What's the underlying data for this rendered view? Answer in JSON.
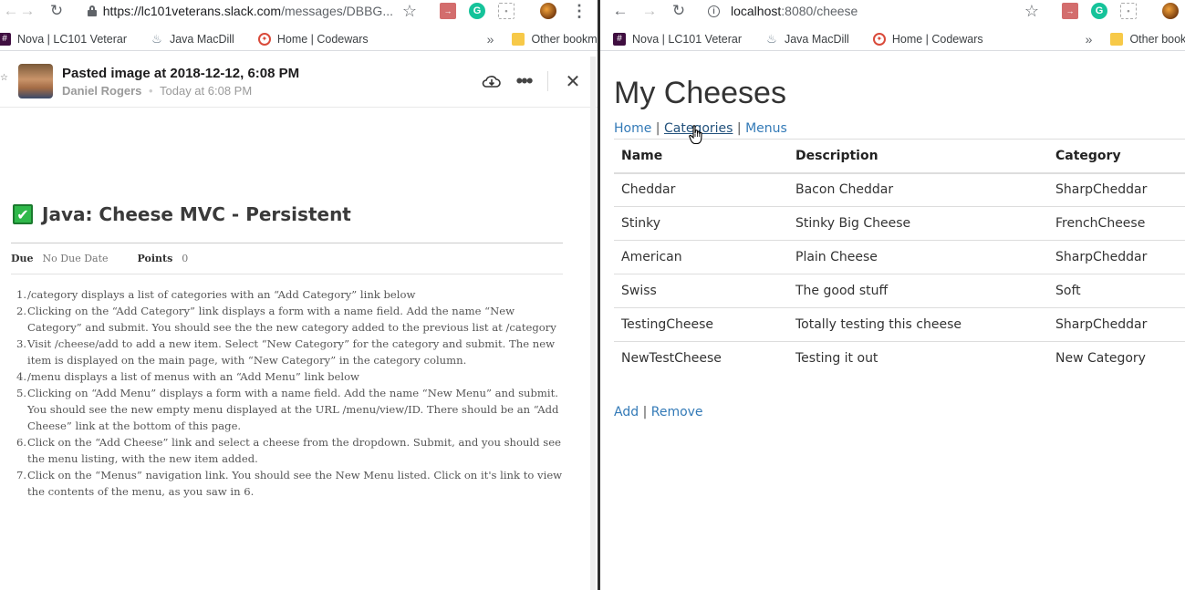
{
  "left_browser": {
    "url_secure": "https://lc101veterans.slack.com",
    "url_rest": "/messages/DBBG...",
    "bookmarks": [
      "Nova | LC101 Veterar",
      "Java MacDill",
      "Home | Codewars"
    ],
    "other_bookmarks": "Other bookmarks"
  },
  "right_browser": {
    "url_host": "localhost",
    "url_rest": ":8080/cheese",
    "bookmarks": [
      "Nova | LC101 Veterar",
      "Java MacDill",
      "Home | Codewars"
    ],
    "other_bookmarks": "Other bookm"
  },
  "slack": {
    "title": "Pasted image at 2018-12-12, 6:08 PM",
    "author": "Daniel Rogers",
    "time": "Today at 6:08 PM",
    "bullet": "•",
    "edge_glyph": "☆"
  },
  "assignment": {
    "title": "Java: Cheese MVC - Persistent",
    "due_label": "Due",
    "due_value": "No Due Date",
    "points_label": "Points",
    "points_value": "0",
    "steps": [
      "/category displays a list of categories with an “Add Category” link below",
      "Clicking on the “Add Category” link displays a form with a name field. Add the name “New Category” and submit. You should see the the new category added to the previous list at /category",
      "Visit /cheese/add to add a new item. Select “New Category” for the category and submit. The new item is displayed on the main page, with “New Category” in the category column.",
      "/menu displays a list of menus with an “Add Menu” link below",
      "Clicking on “Add Menu” displays a form with a name field. Add the name “New Menu” and submit. You should see the new empty menu displayed at the URL /menu/view/ID. There should be an “Add Cheese” link at the bottom of this page.",
      "Click on the “Add Cheese” link and select a cheese from the dropdown. Submit, and you should see the menu listing, with the new item added.",
      "Click on the “Menus” navigation link. You should see the New Menu listed. Click on it's link to view the contents of the menu, as you saw in 6."
    ]
  },
  "cheese_page": {
    "title": "My Cheeses",
    "nav": [
      "Home",
      "Categories",
      "Menus"
    ],
    "separator": "|",
    "columns": [
      "Name",
      "Description",
      "Category"
    ],
    "rows": [
      [
        "Cheddar",
        "Bacon Cheddar",
        "SharpCheddar"
      ],
      [
        "Stinky",
        "Stinky Big Cheese",
        "FrenchCheese"
      ],
      [
        "American",
        "Plain Cheese",
        "SharpCheddar"
      ],
      [
        "Swiss",
        "The good stuff",
        "Soft"
      ],
      [
        "TestingCheese",
        "Totally testing this cheese",
        "SharpCheddar"
      ],
      [
        "NewTestCheese",
        "Testing it out",
        "New Category"
      ]
    ],
    "actions": [
      "Add",
      "Remove"
    ]
  },
  "colors": {
    "link": "#337ab7",
    "check_green": "#2fb84a",
    "slack_purple": "#3f0e40"
  }
}
